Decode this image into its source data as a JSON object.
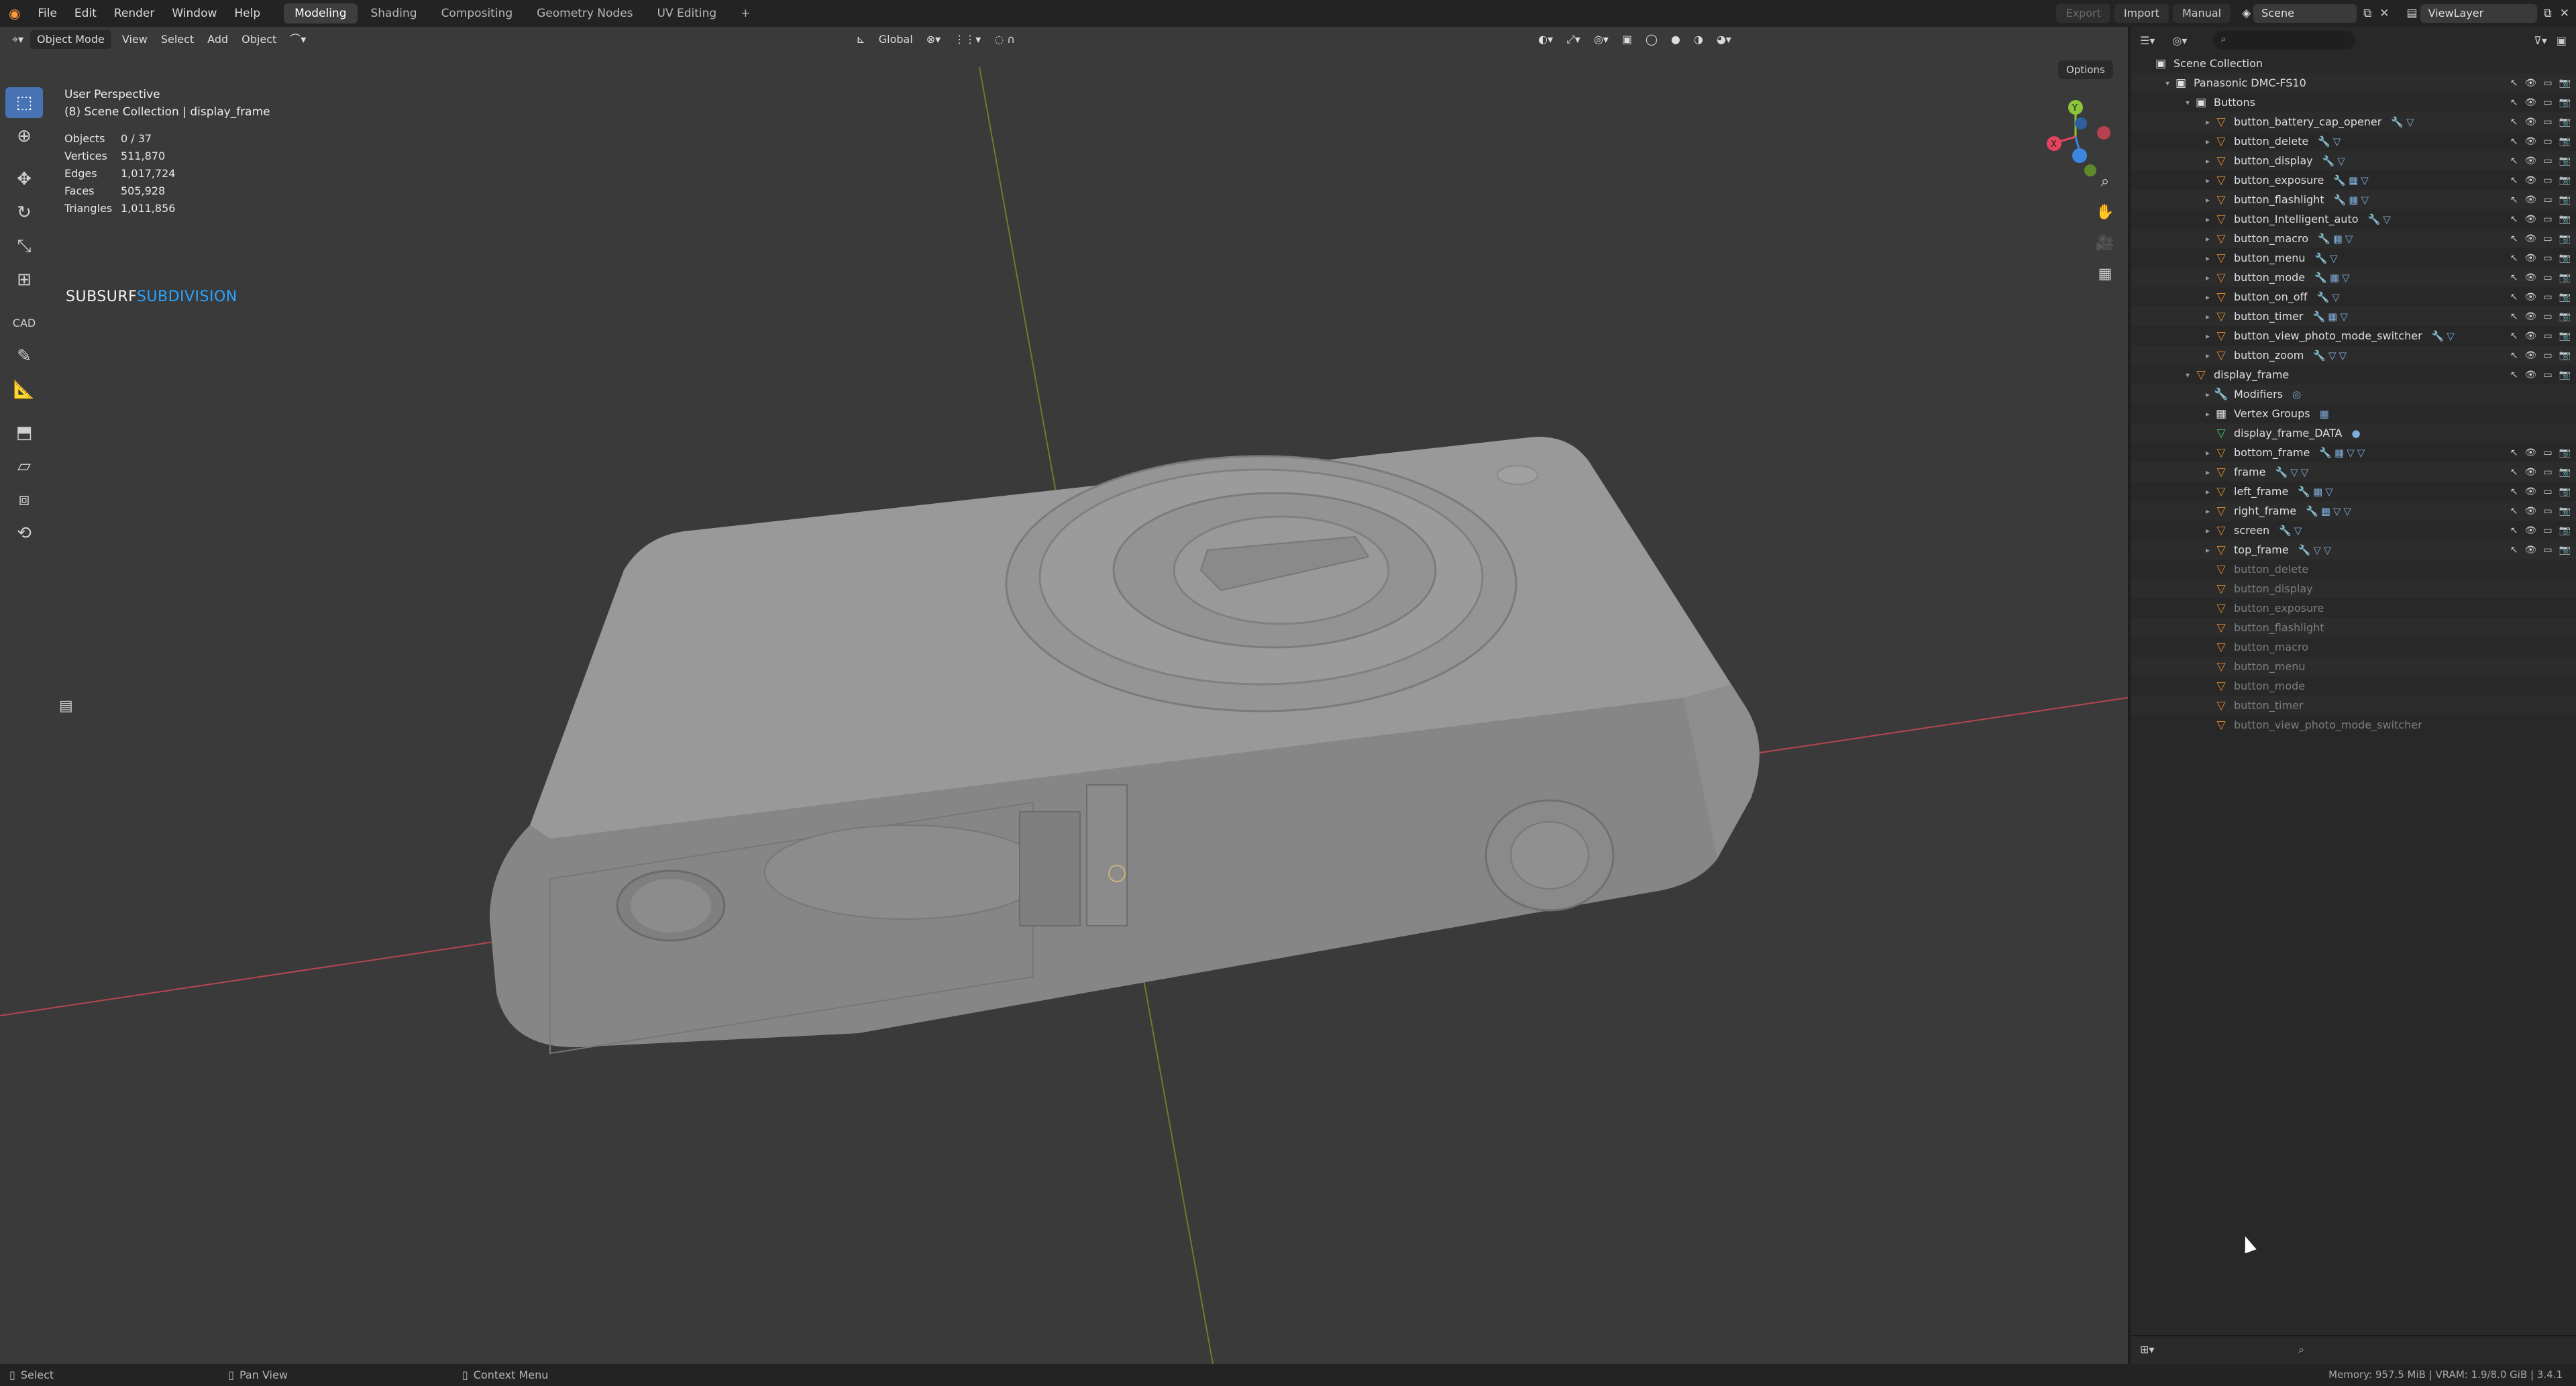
{
  "topbar": {
    "menu": [
      "File",
      "Edit",
      "Render",
      "Window",
      "Help"
    ],
    "workspaces": [
      "Modeling",
      "Shading",
      "Compositing",
      "Geometry Nodes",
      "UV Editing"
    ],
    "active_workspace": "Modeling",
    "add_tab": "+",
    "export_label": "Export",
    "import_label": "Import",
    "manual_label": "Manual",
    "scene_value": "Scene",
    "viewlayer_value": "ViewLayer"
  },
  "viewport": {
    "header": {
      "mode": "Object Mode",
      "menu": [
        "View",
        "Select",
        "Add",
        "Object"
      ],
      "orientation": "Global",
      "options_label": "Options"
    },
    "overlay": {
      "perspective": "User Perspective",
      "collection": "(8) Scene Collection | display_frame",
      "stats": [
        {
          "k": "Objects",
          "v": "0 / 37"
        },
        {
          "k": "Vertices",
          "v": "511,870"
        },
        {
          "k": "Edges",
          "v": "1,017,724"
        },
        {
          "k": "Faces",
          "v": "505,928"
        },
        {
          "k": "Triangles",
          "v": "1,011,856"
        }
      ],
      "subsurf_a": "SUBSURF",
      "subsurf_b": "SUBDIVISION"
    },
    "axis_colors": {
      "x": "#e5455c",
      "y": "#8ac53a",
      "z": "#3d86e0"
    },
    "tools": [
      "select-box",
      "cursor",
      "move",
      "rotate",
      "scale",
      "transform",
      "cad",
      "annotate",
      "measure",
      "add-cube",
      "shear",
      "grab",
      "spin"
    ]
  },
  "outliner": {
    "rows": [
      {
        "name": "Scene Collection",
        "indent": 0,
        "icon": "collection",
        "arrow": ""
      },
      {
        "name": "Panasonic DMC-FS10",
        "indent": 1,
        "icon": "collection",
        "arrow": "▾",
        "vis": true
      },
      {
        "name": "Buttons",
        "indent": 2,
        "icon": "collection",
        "arrow": "▾",
        "vis": true
      },
      {
        "name": "button_battery_cap_opener",
        "indent": 3,
        "icon": "mesh",
        "arrow": "▸",
        "tags": "🔧▽",
        "vis": true
      },
      {
        "name": "button_delete",
        "indent": 3,
        "icon": "mesh",
        "arrow": "▸",
        "tags": "🔧▽",
        "vis": true
      },
      {
        "name": "button_display",
        "indent": 3,
        "icon": "mesh",
        "arrow": "▸",
        "tags": "🔧▽",
        "vis": true
      },
      {
        "name": "button_exposure",
        "indent": 3,
        "icon": "mesh",
        "arrow": "▸",
        "tags": "🔧▦▽",
        "vis": true
      },
      {
        "name": "button_flashlight",
        "indent": 3,
        "icon": "mesh",
        "arrow": "▸",
        "tags": "🔧▦▽",
        "vis": true
      },
      {
        "name": "button_Intelligent_auto",
        "indent": 3,
        "icon": "mesh",
        "arrow": "▸",
        "tags": "🔧▽",
        "vis": true
      },
      {
        "name": "button_macro",
        "indent": 3,
        "icon": "mesh",
        "arrow": "▸",
        "tags": "🔧▦▽",
        "vis": true
      },
      {
        "name": "button_menu",
        "indent": 3,
        "icon": "mesh",
        "arrow": "▸",
        "tags": "🔧▽",
        "vis": true
      },
      {
        "name": "button_mode",
        "indent": 3,
        "icon": "mesh",
        "arrow": "▸",
        "tags": "🔧▦▽",
        "vis": true
      },
      {
        "name": "button_on_off",
        "indent": 3,
        "icon": "mesh",
        "arrow": "▸",
        "tags": "🔧▽",
        "vis": true
      },
      {
        "name": "button_timer",
        "indent": 3,
        "icon": "mesh",
        "arrow": "▸",
        "tags": "🔧▦▽",
        "vis": true
      },
      {
        "name": "button_view_photo_mode_switcher",
        "indent": 3,
        "icon": "mesh",
        "arrow": "▸",
        "tags": "🔧▽",
        "vis": true
      },
      {
        "name": "button_zoom",
        "indent": 3,
        "icon": "mesh",
        "arrow": "▸",
        "tags": "🔧▽▽",
        "vis": true
      },
      {
        "name": "display_frame",
        "indent": 2,
        "icon": "mesh",
        "arrow": "▾",
        "vis": true
      },
      {
        "name": "Modifiers",
        "indent": 3,
        "icon": "wrench",
        "arrow": "▸",
        "tags": "◎"
      },
      {
        "name": "Vertex Groups",
        "indent": 3,
        "icon": "grid",
        "arrow": "▸",
        "tags": "▦"
      },
      {
        "name": "display_frame_DATA",
        "indent": 3,
        "icon": "data",
        "arrow": "",
        "tags": "●"
      },
      {
        "name": "bottom_frame",
        "indent": 3,
        "icon": "mesh",
        "arrow": "▸",
        "tags": "🔧▦▽▽",
        "vis": true
      },
      {
        "name": "frame",
        "indent": 3,
        "icon": "mesh",
        "arrow": "▸",
        "tags": "🔧▽▽",
        "vis": true
      },
      {
        "name": "left_frame",
        "indent": 3,
        "icon": "mesh",
        "arrow": "▸",
        "tags": "🔧▦▽",
        "vis": true
      },
      {
        "name": "right_frame",
        "indent": 3,
        "icon": "mesh",
        "arrow": "▸",
        "tags": "🔧▦▽▽",
        "vis": true
      },
      {
        "name": "screen",
        "indent": 3,
        "icon": "mesh",
        "arrow": "▸",
        "tags": "🔧▽",
        "vis": true
      },
      {
        "name": "top_frame",
        "indent": 3,
        "icon": "mesh",
        "arrow": "▸",
        "tags": "🔧▽▽",
        "vis": true
      },
      {
        "name": "button_delete",
        "indent": 3,
        "icon": "mesh",
        "arrow": "",
        "dim": true
      },
      {
        "name": "button_display",
        "indent": 3,
        "icon": "mesh",
        "arrow": "",
        "dim": true
      },
      {
        "name": "button_exposure",
        "indent": 3,
        "icon": "mesh",
        "arrow": "",
        "dim": true
      },
      {
        "name": "button_flashlight",
        "indent": 3,
        "icon": "mesh",
        "arrow": "",
        "dim": true
      },
      {
        "name": "button_macro",
        "indent": 3,
        "icon": "mesh",
        "arrow": "",
        "dim": true
      },
      {
        "name": "button_menu",
        "indent": 3,
        "icon": "mesh",
        "arrow": "",
        "dim": true
      },
      {
        "name": "button_mode",
        "indent": 3,
        "icon": "mesh",
        "arrow": "",
        "dim": true
      },
      {
        "name": "button_timer",
        "indent": 3,
        "icon": "mesh",
        "arrow": "",
        "dim": true
      },
      {
        "name": "button_view_photo_mode_switcher",
        "indent": 3,
        "icon": "mesh",
        "arrow": "",
        "dim": true
      }
    ]
  },
  "statusbar": {
    "select": "Select",
    "pan": "Pan View",
    "context": "Context Menu",
    "memory": "Memory: 957.5 MiB | VRAM: 1.9/8.0 GiB | 3.4.1"
  }
}
